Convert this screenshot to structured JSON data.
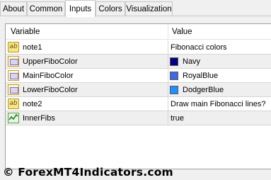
{
  "tabs": [
    "About",
    "Common",
    "Inputs",
    "Colors",
    "Visualization"
  ],
  "active_tab": "Inputs",
  "table": {
    "headers": {
      "variable": "Variable",
      "value": "Value"
    },
    "rows": [
      {
        "icon": "ab-string-icon",
        "name": "note1",
        "value": "Fibonacci colors"
      },
      {
        "icon": "color-icon",
        "name": "UpperFiboColor",
        "value": "Navy",
        "swatch": "#000080"
      },
      {
        "icon": "color-icon",
        "name": "MainFiboColor",
        "value": "RoyalBlue",
        "swatch": "#4169E1"
      },
      {
        "icon": "color-icon",
        "name": "LowerFiboColor",
        "value": "DodgerBlue",
        "swatch": "#1E90FF"
      },
      {
        "icon": "ab-string-icon",
        "name": "note2",
        "value": "Draw main Fibonacci lines?"
      },
      {
        "icon": "bool-icon",
        "name": "InnerFibs",
        "value": "true"
      }
    ]
  },
  "watermark": "© ForexMT4Indicators.com"
}
